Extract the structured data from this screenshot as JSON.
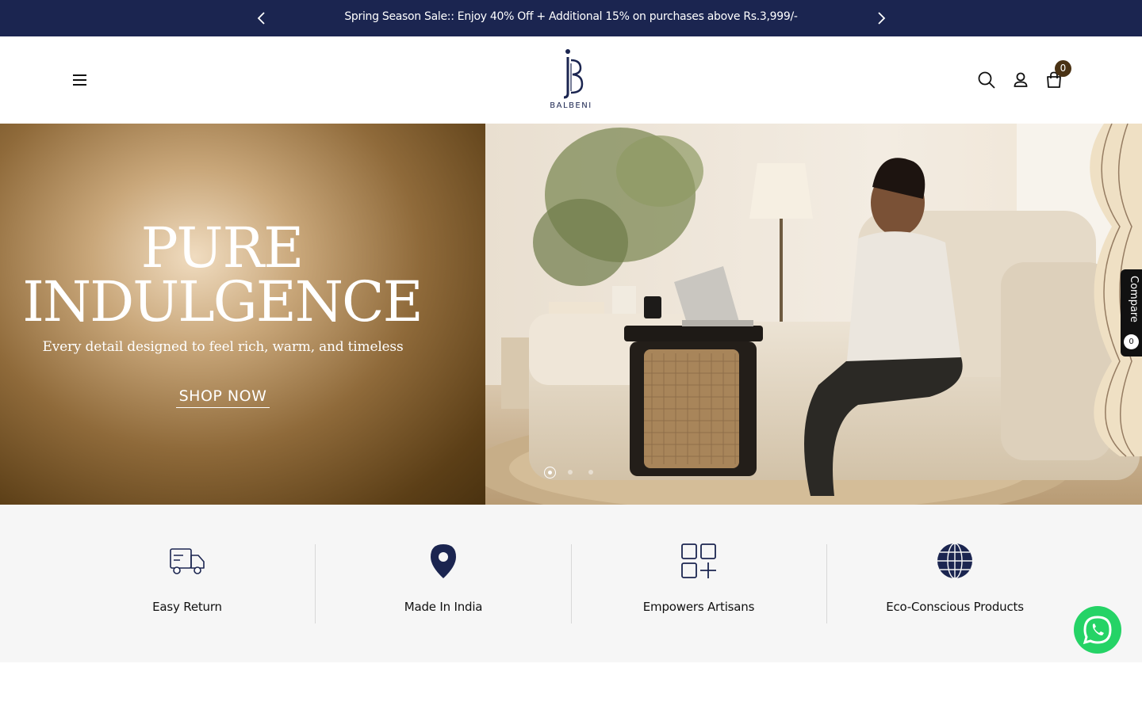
{
  "announcement": {
    "text": "Spring Season Sale:: Enjoy 40% Off + Additional 15% on purchases above Rs.3,999/-"
  },
  "header": {
    "brand": "BALBENI",
    "cart_count": "0"
  },
  "hero": {
    "title_line1": "PURE",
    "title_line2": "INDULGENCE",
    "subtitle": "Every detail designed to feel rich, warm, and timeless",
    "cta": "SHOP NOW",
    "slide_count": 3,
    "active_slide": 1
  },
  "compare": {
    "label": "Compare",
    "count": "0"
  },
  "features": [
    {
      "label": "Easy Return",
      "icon": "delivery-truck-icon"
    },
    {
      "label": "Made In India",
      "icon": "map-pin-icon"
    },
    {
      "label": "Empowers Artisans",
      "icon": "grid-plus-icon"
    },
    {
      "label": "Eco-Conscious Products",
      "icon": "globe-icon"
    }
  ],
  "colors": {
    "brand_navy": "#1b2550",
    "cart_badge": "#4a3214",
    "whatsapp": "#25d366",
    "features_bg": "#f6f6f6"
  }
}
